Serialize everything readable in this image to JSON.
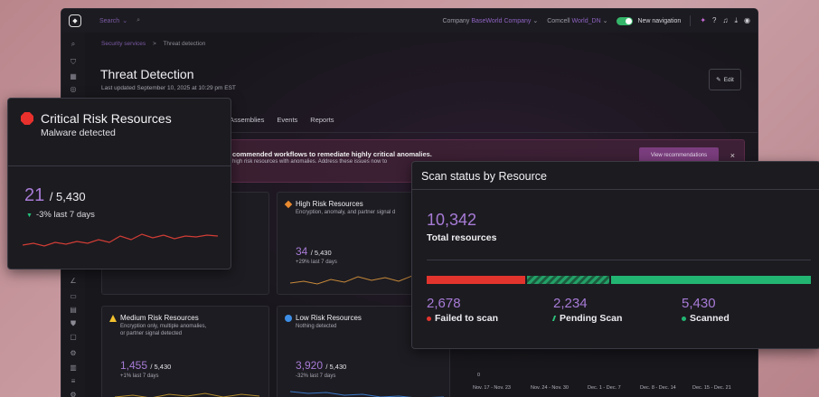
{
  "topbar": {
    "search_label": "Search",
    "company_label": "Company",
    "company_value": "BaseWorld Company",
    "location_label": "Comcell",
    "location_value": "World_DN",
    "nav_toggle_label": "New navigation"
  },
  "breadcrumb": {
    "parent": "Security services",
    "separator": ">",
    "current": "Threat detection"
  },
  "page": {
    "title": "Threat Detection",
    "updated": "Last updated September 10, 2025 at 10:29 pm EST",
    "edit_label": "Edit"
  },
  "tabs": [
    "Assemblies",
    "Events",
    "Reports"
  ],
  "banner": {
    "title": "commended workflows to remediate highly critical anomalies.",
    "subtitle": "high risk resources with anomalies. Address these issues now to",
    "button": "View recommendations",
    "close": "×"
  },
  "cards": {
    "high": {
      "title": "High Risk Resources",
      "subtitle": "Encryption, anomaly, and partner signal d",
      "value": "34",
      "total": "/ 5,430",
      "delta": "+29% last 7 days",
      "color": "#e98a2f"
    },
    "medium": {
      "title": "Medium Risk Resources",
      "subtitle1": "Encryption only, multiple anomalies,",
      "subtitle2": "or partner signal detected",
      "value": "1,455",
      "total": "/ 5,430",
      "delta": "+1% last 7 days",
      "color": "#f2c12e"
    },
    "low": {
      "title": "Low Risk Resources",
      "subtitle": "Nothing detected",
      "value": "3,920",
      "total": "/ 5,430",
      "delta": "-32% last 7 days",
      "color": "#3d8ee6"
    }
  },
  "timeline": {
    "zero_label": "0",
    "x_labels": [
      "Nov. 17 - Nov. 23",
      "Nov. 24 - Nov. 30",
      "Dec. 1 - Dec. 7",
      "Dec. 8 - Dec. 14",
      "Dec. 15 - Dec. 21"
    ]
  },
  "critical_popup": {
    "title": "Critical Risk Resources",
    "subtitle": "Malware detected",
    "value": "21",
    "total": "/ 5,430",
    "delta": "-3% last 7 days",
    "color": "#e8302c"
  },
  "scan_popup": {
    "title": "Scan status by Resource",
    "total_value": "10,342",
    "total_label": "Total resources",
    "stats": [
      {
        "value": "2,678",
        "label": "Failed to scan",
        "color": "#e2342d"
      },
      {
        "value": "2,234",
        "label": "Pending Scan",
        "color": "#2ec27c"
      },
      {
        "value": "5,430",
        "label": "Scanned",
        "color": "#22b572"
      }
    ]
  }
}
